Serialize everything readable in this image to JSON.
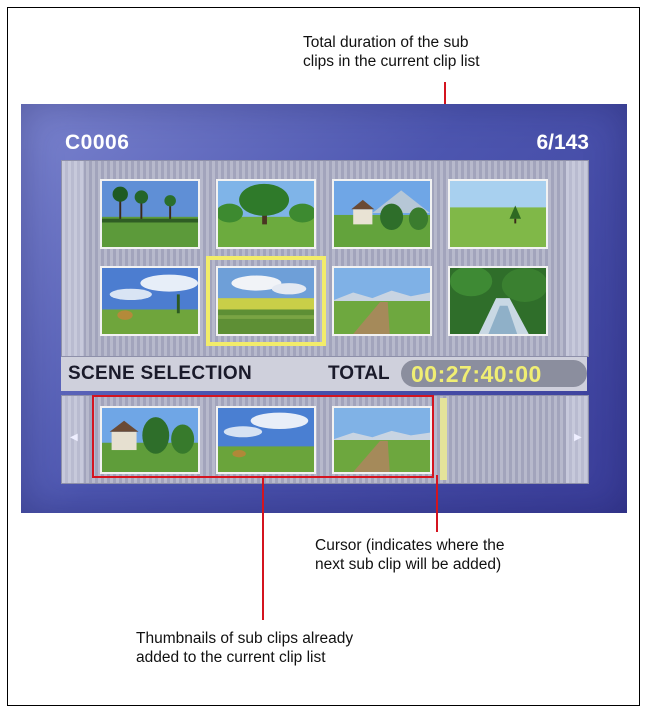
{
  "callouts": {
    "total_duration": "Total duration of the sub\nclips in the current clip list",
    "cursor": "Cursor (indicates where the\nnext sub clip will be added)",
    "thumbnails": "Thumbnails of sub clips already\nadded to the current clip list"
  },
  "screen": {
    "clip_id": "C0006",
    "counter": "6/143",
    "status": {
      "scene_label": "SCENE SELECTION",
      "total_label": "TOTAL",
      "timecode": "00:27:40:00"
    },
    "colors": {
      "background": "#4d56b0",
      "selection": "#f2ec6a",
      "timecode": "#f0ee73",
      "annotation": "#d4141f"
    },
    "clip_grid": [
      {
        "scene": "palm-trees"
      },
      {
        "scene": "large-tree"
      },
      {
        "scene": "house-mountain"
      },
      {
        "scene": "meadow-tree"
      },
      {
        "scene": "sky-hay"
      },
      {
        "scene": "field-clouds"
      },
      {
        "scene": "field-road"
      },
      {
        "scene": "river-forest"
      }
    ],
    "selected_index": 5,
    "sub_clips": [
      {
        "scene": "house-trees"
      },
      {
        "scene": "sky-field"
      },
      {
        "scene": "field-road"
      }
    ],
    "nav_left_icon": "chevron-left-icon",
    "nav_right_icon": "chevron-right-icon"
  }
}
